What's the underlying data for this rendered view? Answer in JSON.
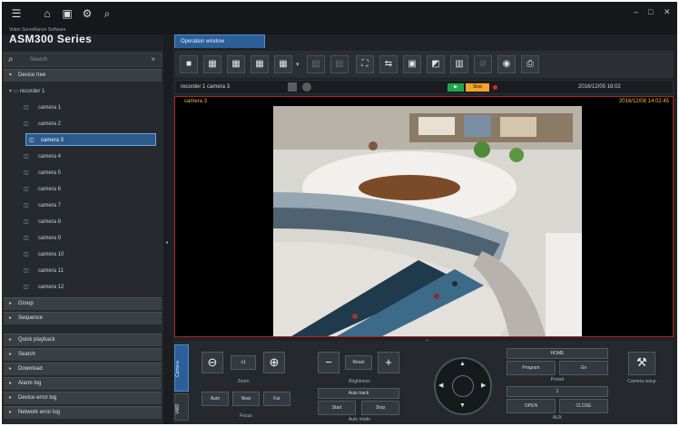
{
  "brand": {
    "subtitle": "Video Surveillance Software",
    "title": "ASM300 Series"
  },
  "window": {
    "controls": [
      "–",
      "□",
      "✕"
    ]
  },
  "tab": {
    "label": "Operation window"
  },
  "search": {
    "placeholder": "Search"
  },
  "left_panel": {
    "device_tree": "Device tree",
    "recorder": "recorder 1",
    "cameras": [
      "camera 1",
      "camera 2",
      "camera 3",
      "camera 4",
      "camera 5",
      "camera 6",
      "camera 7",
      "camera 8",
      "camera 9",
      "camera 10",
      "camera 11",
      "camera 12"
    ],
    "groups": [
      "Group",
      "Sequence"
    ],
    "actions": [
      "Quick playback",
      "Search",
      "Download",
      "Alarm log",
      "Device error log",
      "Network error log"
    ]
  },
  "info_bar": {
    "path": "recorder 1 camera 3",
    "live_label": "Stop",
    "datetime": "2016/12/05 18:02"
  },
  "video": {
    "camera_label": "camera 3",
    "timestamp": "2016/12/08 14:02:45"
  },
  "control_panel": {
    "tabs": [
      "Camera",
      "VMD"
    ],
    "zoom": {
      "label": "Zoom",
      "button_center": "x1"
    },
    "focus": {
      "label": "Focus",
      "auto": "Auto",
      "near": "Near",
      "far": "Far"
    },
    "brightness": {
      "label": "Brightness",
      "reset": "Reset"
    },
    "auto_mode": {
      "label": "Auto mode",
      "mode": "Auto track",
      "start": "Start",
      "stop": "Stop"
    },
    "preset": {
      "label": "Preset",
      "value": "HOME",
      "program": "Program",
      "go": "Go"
    },
    "aux": {
      "label": "AUX",
      "value": "1",
      "open": "OPEN",
      "close": "CLOSE"
    },
    "camera_setup": "Camera setup"
  }
}
